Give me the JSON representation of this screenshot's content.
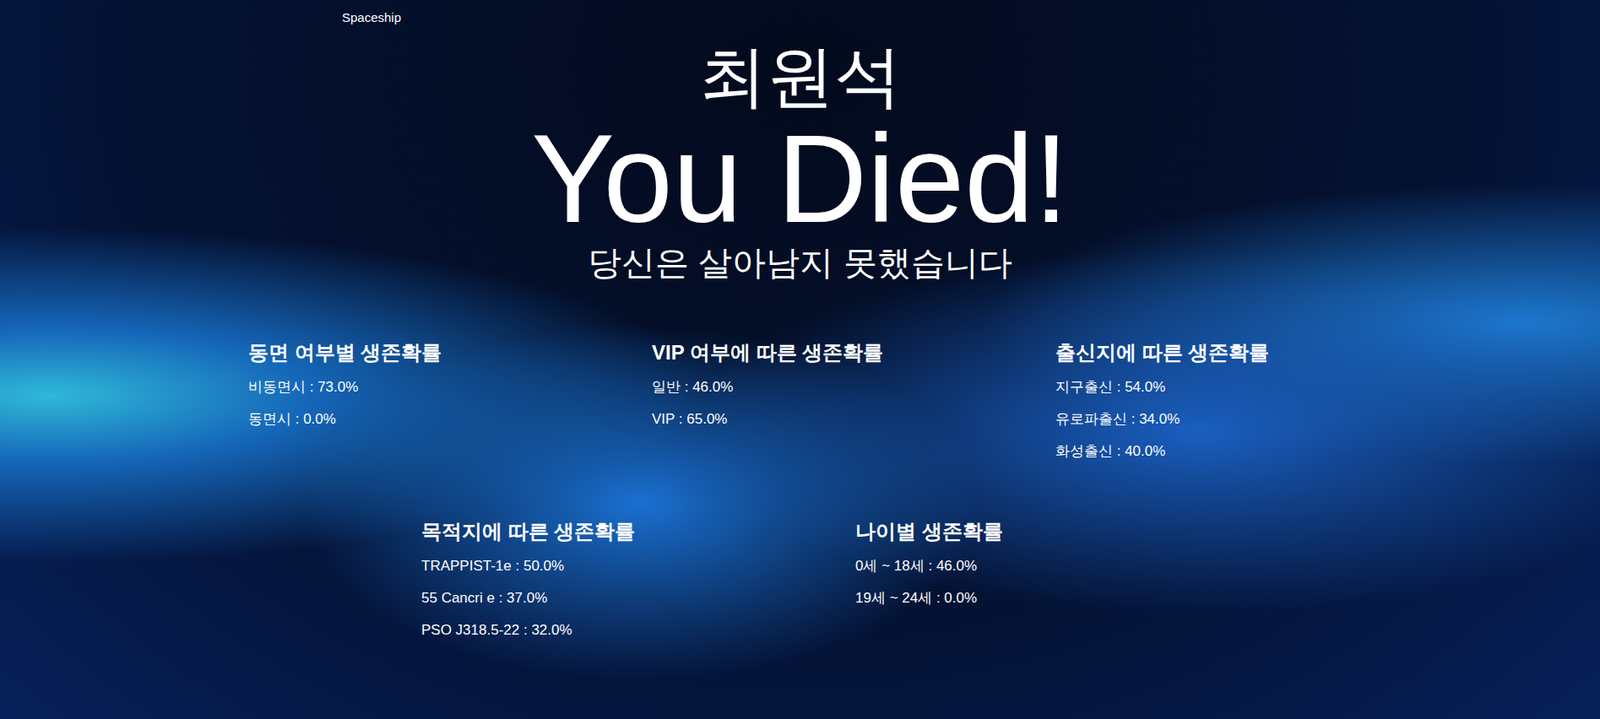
{
  "nav": {
    "brand": "Spaceship"
  },
  "result": {
    "name": "최원석",
    "headline": "You Died!",
    "message": "당신은 살아남지 못했습니다"
  },
  "stats": [
    {
      "title": "동면 여부별 생존확률",
      "rows": [
        "비동면시 : 73.0%",
        "동면시 : 0.0%"
      ]
    },
    {
      "title": "VIP 여부에 따른 생존확률",
      "rows": [
        "일반 : 46.0%",
        "VIP : 65.0%"
      ]
    },
    {
      "title": "출신지에 따른 생존확률",
      "rows": [
        "지구출신 : 54.0%",
        "유로파출신 : 34.0%",
        "화성출신 : 40.0%"
      ]
    },
    {
      "title": "목적지에 따른 생존확률",
      "rows": [
        "TRAPPIST-1e : 50.0%",
        "55 Cancri e : 37.0%",
        "PSO J318.5-22 : 32.0%"
      ]
    },
    {
      "title": "나이별 생존확률",
      "rows": [
        "0세 ~ 18세 : 46.0%",
        "19세 ~ 24세 : 0.0%"
      ]
    }
  ]
}
